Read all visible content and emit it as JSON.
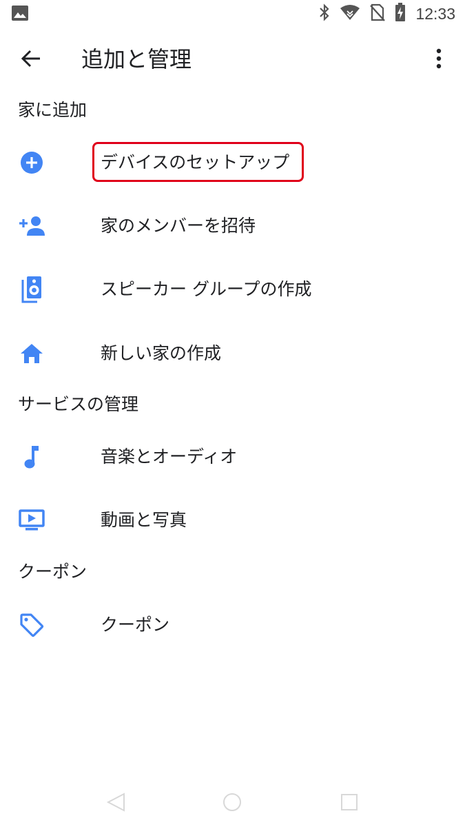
{
  "status_bar": {
    "time": "12:33",
    "icons": [
      "gallery-icon",
      "bluetooth-icon",
      "wifi-icon",
      "no-sim-icon",
      "battery-charging-icon"
    ]
  },
  "app_bar": {
    "title": "追加と管理",
    "back_icon": "arrow-back-icon",
    "more_icon": "more-vert-icon"
  },
  "sections": [
    {
      "header": "家に追加",
      "items": [
        {
          "label": "デバイスのセットアップ",
          "icon": "add-circle-icon",
          "highlighted": true
        },
        {
          "label": "家のメンバーを招待",
          "icon": "person-add-icon"
        },
        {
          "label": "スピーカー グループの作成",
          "icon": "speaker-group-icon"
        },
        {
          "label": "新しい家の作成",
          "icon": "home-icon"
        }
      ]
    },
    {
      "header": "サービスの管理",
      "items": [
        {
          "label": "音楽とオーディオ",
          "icon": "music-note-icon"
        },
        {
          "label": "動画と写真",
          "icon": "video-icon"
        }
      ]
    },
    {
      "header": "クーポン",
      "items": [
        {
          "label": "クーポン",
          "icon": "tag-icon"
        }
      ]
    }
  ],
  "colors": {
    "accent": "#4285f4",
    "highlight_border": "#e0001a",
    "text": "#202124"
  },
  "nav_bar": {
    "icons": [
      "nav-back-icon",
      "nav-home-icon",
      "nav-recents-icon"
    ]
  }
}
